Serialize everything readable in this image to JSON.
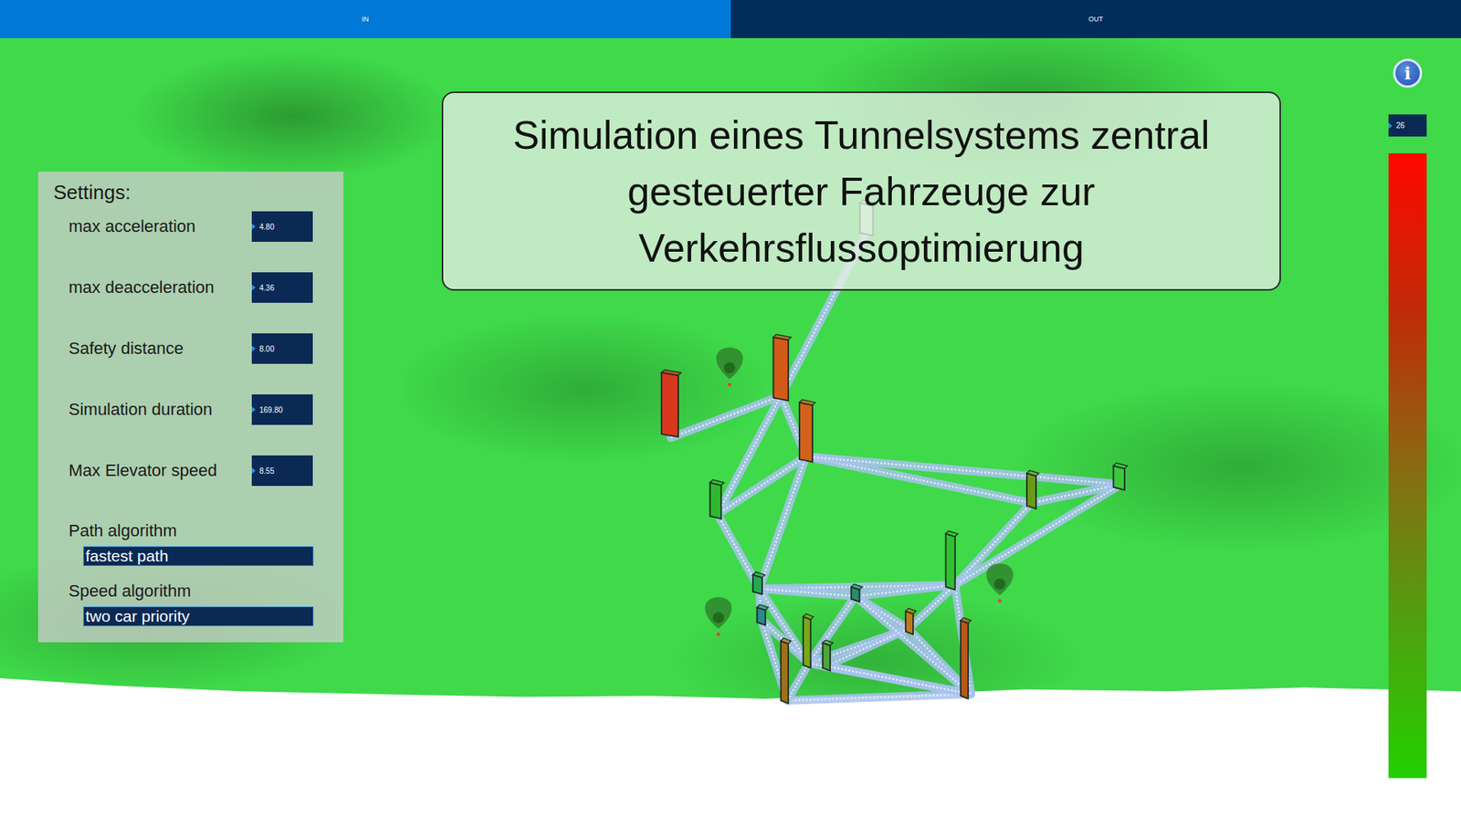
{
  "tabs": [
    {
      "label": "IN",
      "selected": true
    },
    {
      "label": "OUT",
      "selected": false
    }
  ],
  "title": "Simulation eines Tunnelsystems zentral gesteuerter Fahrzeuge zur Verkehrsflussoptimierung",
  "settings": {
    "heading": "Settings:",
    "fields": [
      {
        "label": "max acceleration",
        "value": "4.80"
      },
      {
        "label": "max deacceleration",
        "value": "4.36"
      },
      {
        "label": "Safety distance",
        "value": "8.00"
      },
      {
        "label": "Simulation duration",
        "value": "169.80"
      },
      {
        "label": "Max Elevator speed",
        "value": "8.55"
      }
    ],
    "selects": [
      {
        "label": "Path algorithm",
        "value": "fastest path"
      },
      {
        "label": "Speed algorithm",
        "value": "two car priority"
      }
    ]
  },
  "info_button": {
    "icon": "i"
  },
  "gauge": {
    "reading": "26"
  },
  "elevators": [
    {
      "color": "#a8eca8"
    },
    {
      "color": "#d9381e"
    },
    {
      "color": "#d45a1a"
    },
    {
      "color": "#d4601c"
    },
    {
      "color": "#2fb82f"
    },
    {
      "color": "#6a9a1a"
    },
    {
      "color": "#3cc83c"
    },
    {
      "color": "#2fc02f"
    },
    {
      "color": "#22a855"
    },
    {
      "color": "#2a8a6a"
    },
    {
      "color": "#2a8a8a"
    },
    {
      "color": "#c07a1a"
    },
    {
      "color": "#7aa81a"
    },
    {
      "color": "#4aa83a"
    },
    {
      "color": "#a0701a"
    },
    {
      "color": "#b8581a"
    }
  ]
}
